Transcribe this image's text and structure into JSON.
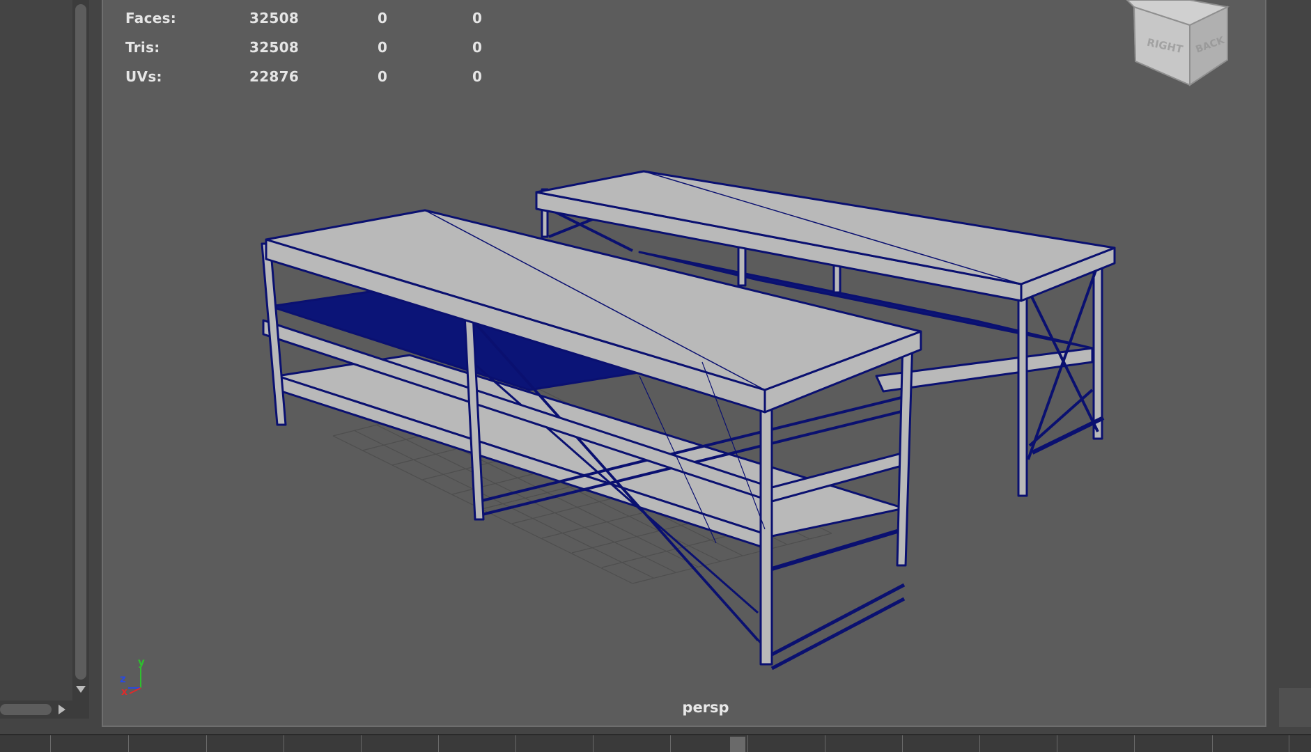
{
  "hud": {
    "rows": [
      {
        "label": "Faces:",
        "v1": "32508",
        "v2": "0",
        "v3": "0"
      },
      {
        "label": "Tris:",
        "v1": "32508",
        "v2": "0",
        "v3": "0"
      },
      {
        "label": "UVs:",
        "v1": "22876",
        "v2": "0",
        "v3": "0"
      }
    ]
  },
  "view_cube": {
    "face_right": "RIGHT",
    "face_back": "BACK"
  },
  "axis_gizmo": {
    "x": "x",
    "y": "y",
    "z": "z"
  },
  "viewport": {
    "camera_label": "persp"
  },
  "colors": {
    "viewport_bg": "#5c5c5c",
    "wireframe": "#0a1070",
    "mesh_face": "#b9b9b9",
    "grid": "#4e4e4e"
  },
  "icons": {
    "scroll_down": "triangle-down-icon",
    "scroll_right": "triangle-right-icon"
  }
}
